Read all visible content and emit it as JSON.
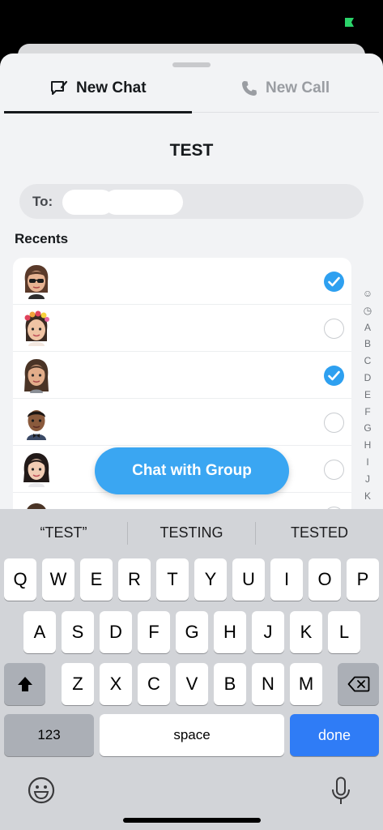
{
  "tabs": {
    "new_chat": "New Chat",
    "new_call": "New Call"
  },
  "group_name": "TEST",
  "to_field": {
    "label": "To:"
  },
  "recents": {
    "heading": "Recents",
    "contacts": [
      {
        "name": "",
        "avatar": "bitmoji-sunglasses",
        "selected": true
      },
      {
        "name": "",
        "avatar": "bitmoji-flower-crown",
        "selected": false
      },
      {
        "name": "",
        "avatar": "bitmoji-long-hair",
        "selected": true
      },
      {
        "name": "",
        "avatar": "bitmoji-bowtie",
        "selected": false
      },
      {
        "name": "",
        "avatar": "bitmoji-dark-hair",
        "selected": false
      }
    ]
  },
  "index_letters": [
    "☺",
    "◷",
    "A",
    "B",
    "C",
    "D",
    "E",
    "F",
    "G",
    "H",
    "I",
    "J",
    "K"
  ],
  "chat_button": "Chat with Group",
  "keyboard": {
    "suggestions": [
      "“TEST”",
      "TESTING",
      "TESTED"
    ],
    "row1": [
      "Q",
      "W",
      "E",
      "R",
      "T",
      "Y",
      "U",
      "I",
      "O",
      "P"
    ],
    "row2": [
      "A",
      "S",
      "D",
      "F",
      "G",
      "H",
      "J",
      "K",
      "L"
    ],
    "row3": [
      "Z",
      "X",
      "C",
      "V",
      "B",
      "N",
      "M"
    ],
    "numbers_key": "123",
    "space_key": "space",
    "done_key": "done"
  },
  "colors": {
    "accent": "#3aa6f2",
    "check": "#2ea0f0",
    "done": "#2f7cf6",
    "keyboard_bg": "#d2d4d8"
  }
}
